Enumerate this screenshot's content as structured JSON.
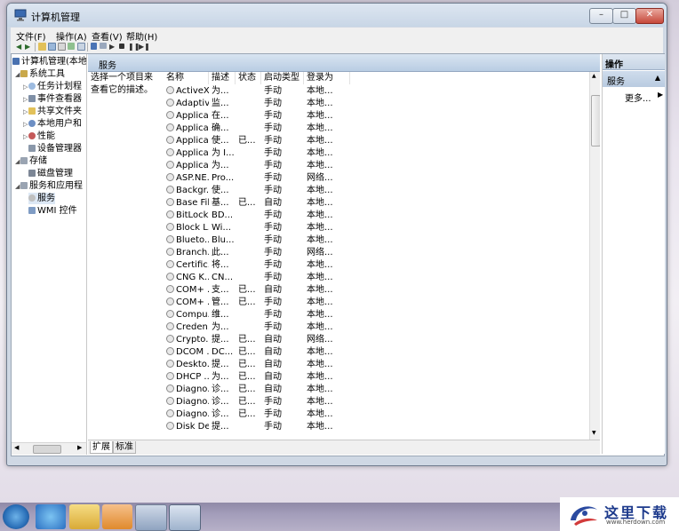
{
  "window": {
    "title": "计算机管理"
  },
  "menu": [
    "文件(F)",
    "操作(A)",
    "查看(V)",
    "帮助(H)"
  ],
  "tree": [
    {
      "label": "计算机管理(本地",
      "level": 0,
      "expander": ""
    },
    {
      "label": "系统工具",
      "level": 1,
      "expander": "◢"
    },
    {
      "label": "任务计划程",
      "level": 2,
      "expander": "▷"
    },
    {
      "label": "事件查看器",
      "level": 2,
      "expander": "▷"
    },
    {
      "label": "共享文件夹",
      "level": 2,
      "expander": "▷"
    },
    {
      "label": "本地用户和",
      "level": 2,
      "expander": "▷"
    },
    {
      "label": "性能",
      "level": 2,
      "expander": "▷"
    },
    {
      "label": "设备管理器",
      "level": 2,
      "expander": ""
    },
    {
      "label": "存储",
      "level": 1,
      "expander": "◢"
    },
    {
      "label": "磁盘管理",
      "level": 2,
      "expander": ""
    },
    {
      "label": "服务和应用程",
      "level": 1,
      "expander": "◢"
    },
    {
      "label": "服务",
      "level": 2,
      "expander": ""
    },
    {
      "label": "WMI 控件",
      "level": 2,
      "expander": ""
    }
  ],
  "pane": {
    "header": "服务",
    "description": "选择一个项目来查看它的描述。",
    "tabs": [
      "扩展",
      "标准"
    ]
  },
  "columns": [
    "名称",
    "描述",
    "状态",
    "启动类型",
    "登录为"
  ],
  "services": [
    [
      "ActiveX...",
      "为...",
      "",
      "手动",
      "本地..."
    ],
    [
      "Adaptiv...",
      "监...",
      "",
      "手动",
      "本地..."
    ],
    [
      "Applica...",
      "在...",
      "",
      "手动",
      "本地..."
    ],
    [
      "Applica...",
      "确...",
      "",
      "手动",
      "本地..."
    ],
    [
      "Applica...",
      "使...",
      "已...",
      "手动",
      "本地..."
    ],
    [
      "Applica...",
      "为 I...",
      "",
      "手动",
      "本地..."
    ],
    [
      "Applica...",
      "为...",
      "",
      "手动",
      "本地..."
    ],
    [
      "ASP.NE...",
      "Pro...",
      "",
      "手动",
      "网络..."
    ],
    [
      "Backgr...",
      "使...",
      "",
      "手动",
      "本地..."
    ],
    [
      "Base Fil...",
      "基...",
      "已...",
      "自动",
      "本地..."
    ],
    [
      "BitLock...",
      "BD...",
      "",
      "手动",
      "本地..."
    ],
    [
      "Block L...",
      "Wi...",
      "",
      "手动",
      "本地..."
    ],
    [
      "Blueto...",
      "Blu...",
      "",
      "手动",
      "本地..."
    ],
    [
      "Branch...",
      "此...",
      "",
      "手动",
      "网络..."
    ],
    [
      "Certific...",
      "将...",
      "",
      "手动",
      "本地..."
    ],
    [
      "CNG K...",
      "CN...",
      "",
      "手动",
      "本地..."
    ],
    [
      "COM+ ...",
      "支...",
      "已...",
      "自动",
      "本地..."
    ],
    [
      "COM+ ...",
      "管...",
      "已...",
      "手动",
      "本地..."
    ],
    [
      "Compu...",
      "维...",
      "",
      "手动",
      "本地..."
    ],
    [
      "Creden...",
      "为...",
      "",
      "手动",
      "本地..."
    ],
    [
      "Crypto...",
      "提...",
      "已...",
      "自动",
      "网络..."
    ],
    [
      "DCOM ...",
      "DC...",
      "已...",
      "自动",
      "本地..."
    ],
    [
      "Deskto...",
      "提...",
      "已...",
      "自动",
      "本地..."
    ],
    [
      "DHCP ...",
      "为...",
      "已...",
      "自动",
      "本地..."
    ],
    [
      "Diagno...",
      "诊...",
      "已...",
      "自动",
      "本地..."
    ],
    [
      "Diagno...",
      "诊...",
      "已...",
      "手动",
      "本地..."
    ],
    [
      "Diagno...",
      "诊...",
      "已...",
      "手动",
      "本地..."
    ],
    [
      "Disk De...",
      "提...",
      "",
      "手动",
      "本地..."
    ]
  ],
  "actions": {
    "header": "操作",
    "section": "服务",
    "more": "更多..."
  },
  "watermark": {
    "text": "这里下载",
    "url": "www.herdown.com"
  },
  "colors": {
    "title_bar": "#c8d6e6",
    "pane_header": "#b9cde3",
    "taskbar": "#a39dba"
  }
}
